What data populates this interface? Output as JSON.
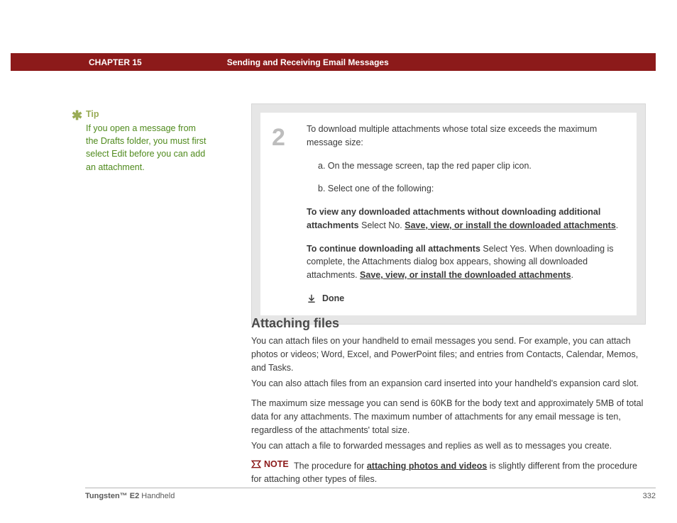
{
  "header": {
    "chapter": "CHAPTER 15",
    "title": "Sending and Receiving Email Messages"
  },
  "tip": {
    "heading": "Tip",
    "body": "If you open a message from the Drafts folder, you must first select Edit before you can add an attachment."
  },
  "step": {
    "number": "2",
    "intro": "To download multiple attachments whose total size exceeds the maximum message size:",
    "sub_a": "a.  On the message screen, tap the red paper clip icon.",
    "sub_b": "b.  Select one of the following:",
    "opt1_lead": "To view any downloaded attachments without downloading additional attachments",
    "opt1_text": "   Select No. ",
    "opt1_link": "Save, view, or install the downloaded attachments",
    "opt2_lead": "To continue downloading all attachments",
    "opt2_text": "   Select Yes. When downloading is complete, the Attachments dialog box appears, showing all downloaded attachments. ",
    "opt2_link": "Save, view, or install the downloaded attachments",
    "done": "Done"
  },
  "section": {
    "title": "Attaching files",
    "p1": "You can attach files on your handheld to email messages you send. For example, you can attach photos or videos; Word, Excel, and PowerPoint files; and entries from Contacts, Calendar, Memos, and Tasks.",
    "p2": "You can also attach files from an expansion card inserted into your handheld's expansion card slot.",
    "p3": "The maximum size message you can send is 60KB for the body text and approximately 5MB of total data for any attachments. The maximum number of attachments for any email message is ten, regardless of the attachments' total size.",
    "p4": "You can attach a file to forwarded messages and replies as well as to messages you create.",
    "note_label": "NOTE",
    "note_pre": "The procedure for ",
    "note_link": "attaching photos and videos",
    "note_post": " is slightly different from the procedure for attaching other types of files."
  },
  "footer": {
    "product_bold": "Tungsten™ E2",
    "product_rest": " Handheld",
    "page": "332"
  }
}
